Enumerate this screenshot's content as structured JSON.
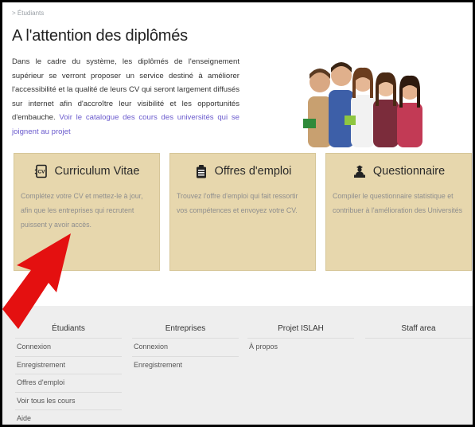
{
  "breadcrumb": "> Étudiants",
  "title": "A l'attention des diplômés",
  "intro": {
    "text": "Dans le cadre du système, les diplômés de l'enseignement supérieur se verront proposer un service destiné à améliorer l'accessibilité et la qualité de leurs CV qui seront largement diffusés sur internet afin d'accroître leur visibilité et les opportunités d'embauche.",
    "link": "Voir le catalogue des cours des universités qui se joignent au projet"
  },
  "cards": [
    {
      "icon": "cv-icon",
      "title": "Curriculum Vitae",
      "description": "Complétez votre CV et mettez-le à jour, afin que les entreprises qui recrutent puissent y avoir accès."
    },
    {
      "icon": "briefcase-list-icon",
      "title": "Offres d'emploi",
      "description": "Trouvez l'offre d'emploi qui fait ressortir vos compétences et envoyez votre CV."
    },
    {
      "icon": "person-desk-icon",
      "title": "Questionnaire",
      "description": "Compiler le questionnaire statistique et contribuer à l'amélioration des Universités"
    }
  ],
  "footer": {
    "columns": [
      {
        "heading": "Étudiants",
        "links": [
          "Connexion",
          "Enregistrement",
          "Offres d'emploi",
          "Voir tous les cours",
          "Aide"
        ]
      },
      {
        "heading": "Entreprises",
        "links": [
          "Connexion",
          "Enregistrement"
        ]
      },
      {
        "heading": "Projet ISLAH",
        "links": [
          "À propos"
        ]
      },
      {
        "heading": "Staff area",
        "links": []
      }
    ]
  },
  "colors": {
    "card_background": "#e7d7ad",
    "link": "#6a5acd",
    "arrow": "#e41010",
    "footer_background": "#eeeeee"
  }
}
